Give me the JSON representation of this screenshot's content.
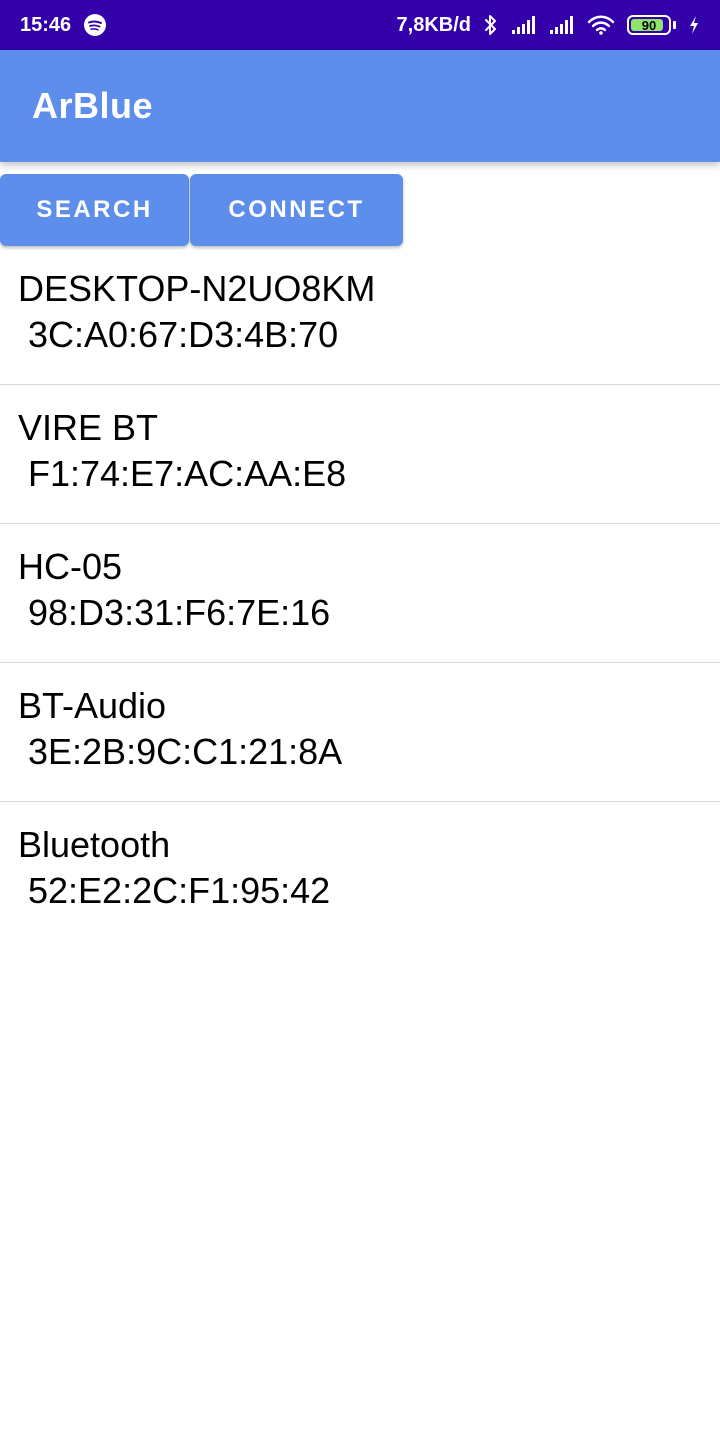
{
  "status_bar": {
    "time": "15:46",
    "network_speed": "7,8KB/d",
    "battery_level": 90,
    "battery_label": "90",
    "icons": [
      "spotify-icon",
      "bluetooth-icon",
      "signal-icon",
      "signal-icon",
      "wifi-icon",
      "battery-icon",
      "charging-icon"
    ]
  },
  "app_bar": {
    "title": "ArBlue"
  },
  "buttons": {
    "search_label": "SEARCH",
    "connect_label": "CONNECT"
  },
  "devices": [
    {
      "name": "DESKTOP-N2UO8KM",
      "mac": "3C:A0:67:D3:4B:70"
    },
    {
      "name": "VIRE BT",
      "mac": "F1:74:E7:AC:AA:E8"
    },
    {
      "name": "HC-05",
      "mac": "98:D3:31:F6:7E:16"
    },
    {
      "name": "BT-Audio",
      "mac": "3E:2B:9C:C1:21:8A"
    },
    {
      "name": "Bluetooth",
      "mac": "52:E2:2C:F1:95:42"
    }
  ],
  "colors": {
    "status_bar": "#3300aa",
    "primary": "#5e8eec",
    "battery_fill": "#8ee56a"
  }
}
